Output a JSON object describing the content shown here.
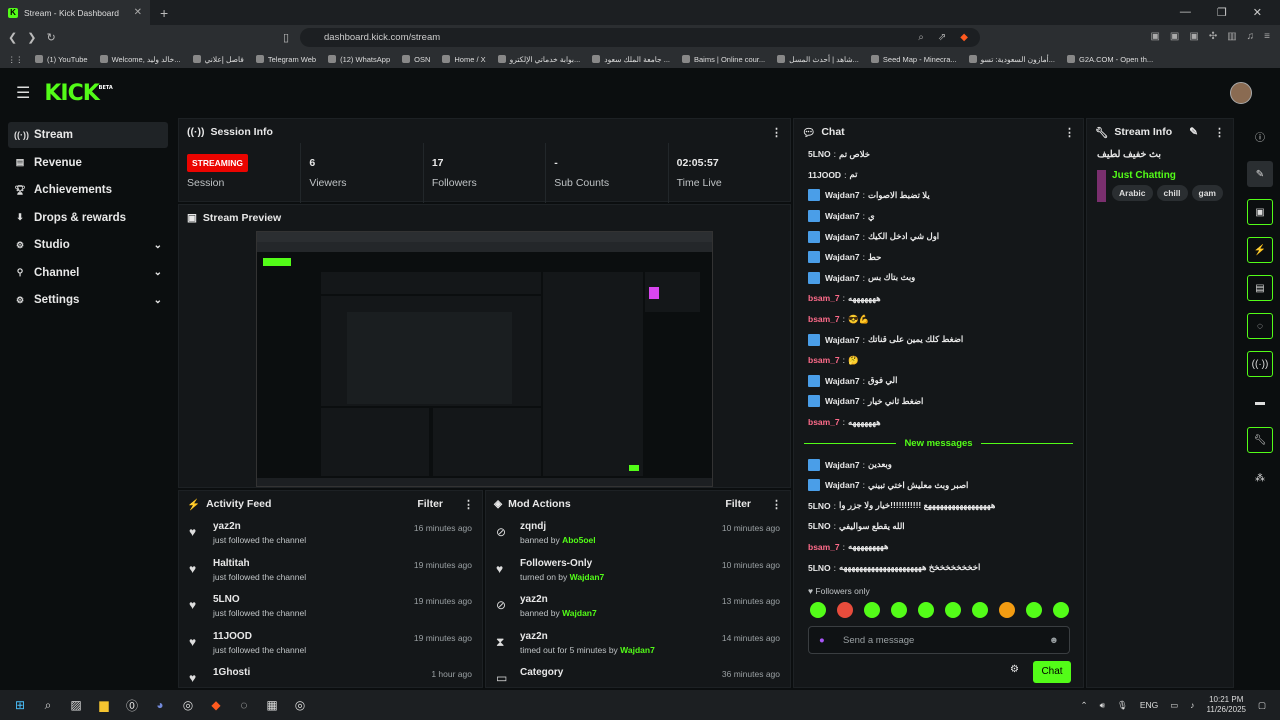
{
  "browser": {
    "tab_title": "Stream - Kick Dashboard",
    "url": "dashboard.kick.com/stream",
    "bookmarks": [
      "(1) YouTube",
      "Welcome, خالد وليد...",
      "فاصل إعلاني",
      "Telegram Web",
      "(12) WhatsApp",
      "OSN",
      "Home / X",
      "بوابة خدماتي الإلكترو...",
      "جامعة الملك سعود ...",
      "Baims | Online cour...",
      "شاهد | أحدث المسل...",
      "Seed Map - Minecra...",
      "أمازون السعودية: تسو...",
      "G2A.COM - Open th..."
    ]
  },
  "brand": {
    "logo": "KICK",
    "beta": "BETA",
    "accent": "#53fc18"
  },
  "sidebar": {
    "items": [
      {
        "label": "Stream"
      },
      {
        "label": "Revenue"
      },
      {
        "label": "Achievements"
      },
      {
        "label": "Drops & rewards"
      },
      {
        "label": "Studio"
      },
      {
        "label": "Channel"
      },
      {
        "label": "Settings"
      }
    ]
  },
  "session": {
    "title": "Session Info",
    "status": "STREAMING",
    "status_label": "Session",
    "viewers": "6",
    "viewers_label": "Viewers",
    "followers": "17",
    "followers_label": "Followers",
    "subs": "-",
    "subs_label": "Sub Counts",
    "time": "02:05:57",
    "time_label": "Time Live"
  },
  "preview": {
    "title": "Stream Preview"
  },
  "activity": {
    "title": "Activity Feed",
    "filter": "Filter",
    "items": [
      {
        "name": "yaz2n",
        "sub": "just followed the channel",
        "time": "16 minutes ago"
      },
      {
        "name": "Haltitah",
        "sub": "just followed the channel",
        "time": "19 minutes ago"
      },
      {
        "name": "5LNO",
        "sub": "just followed the channel",
        "time": "19 minutes ago"
      },
      {
        "name": "11JOOD",
        "sub": "just followed the channel",
        "time": "19 minutes ago"
      },
      {
        "name": "1Ghosti",
        "sub": "",
        "time": "1 hour ago"
      }
    ]
  },
  "mod": {
    "title": "Mod Actions",
    "filter": "Filter",
    "items": [
      {
        "name": "zqndj",
        "pre": "banned by",
        "by": "Abo5oel",
        "time": "10 minutes ago"
      },
      {
        "name": "Followers-Only",
        "pre": "turned on by",
        "by": "Wajdan7",
        "time": "10 minutes ago"
      },
      {
        "name": "yaz2n",
        "pre": "banned by",
        "by": "Wajdan7",
        "time": "13 minutes ago"
      },
      {
        "name": "yaz2n",
        "pre": "timed out for 5 minutes by",
        "by": "Wajdan7",
        "time": "14 minutes ago"
      },
      {
        "name": "Category",
        "pre": "",
        "by": "",
        "time": "36 minutes ago"
      }
    ]
  },
  "chat": {
    "title": "Chat",
    "new_messages": "New messages",
    "followers_only": "Followers only",
    "placeholder": "Send a message",
    "send": "Chat",
    "messages": [
      {
        "user": "5LNO",
        "text": "خلاص تم",
        "mod": false,
        "color": "#e8e8e8"
      },
      {
        "user": "11JOOD",
        "text": "تم",
        "mod": false,
        "color": "#e8e8e8"
      },
      {
        "user": "Wajdan7",
        "text": "يلا تضبط الاصوات",
        "mod": true,
        "color": "#e8e8e8"
      },
      {
        "user": "Wajdan7",
        "text": "ي",
        "mod": true,
        "color": "#e8e8e8"
      },
      {
        "user": "Wajdan7",
        "text": "اول شي ادخل الكيك",
        "mod": true,
        "color": "#e8e8e8"
      },
      {
        "user": "Wajdan7",
        "text": "حط",
        "mod": true,
        "color": "#e8e8e8"
      },
      {
        "user": "Wajdan7",
        "text": "وبث بتاك بس",
        "mod": true,
        "color": "#e8e8e8"
      },
      {
        "user": "bsam_7",
        "text": "هههههههه",
        "mod": false,
        "color": "#ff6b8a"
      },
      {
        "user": "bsam_7",
        "text": "😎💪",
        "mod": false,
        "color": "#ff6b8a"
      },
      {
        "user": "Wajdan7",
        "text": "اضغط كلك يمين على قناتك",
        "mod": true,
        "color": "#e8e8e8"
      },
      {
        "user": "bsam_7",
        "text": "🤔",
        "mod": false,
        "color": "#ff6b8a"
      },
      {
        "user": "Wajdan7",
        "text": "الي فوق",
        "mod": true,
        "color": "#e8e8e8"
      },
      {
        "user": "Wajdan7",
        "text": "اضغط ثاني خيار",
        "mod": true,
        "color": "#e8e8e8"
      },
      {
        "user": "bsam_7",
        "text": "هههههههه",
        "mod": false,
        "color": "#ff6b8a"
      }
    ],
    "new": [
      {
        "user": "Wajdan7",
        "text": "وبعدين",
        "mod": true,
        "color": "#e8e8e8"
      },
      {
        "user": "Wajdan7",
        "text": "اصبر وبث معليش اختي تبيني",
        "mod": true,
        "color": "#e8e8e8"
      },
      {
        "user": "5LNO",
        "text": "هههههههههههههههههع !!!!!!!!!!!خيار ولا جزر وا",
        "mod": false,
        "color": "#e8e8e8"
      },
      {
        "user": "5LNO",
        "text": "الله يقطع سواليفي",
        "mod": false,
        "color": "#e8e8e8"
      },
      {
        "user": "bsam_7",
        "text": "هههههههههه",
        "mod": false,
        "color": "#ff6b8a"
      },
      {
        "user": "5LNO",
        "text": "اخخخخخخخخخ هههههههههههههههههههههه",
        "mod": false,
        "color": "#e8e8e8"
      }
    ]
  },
  "stream_info": {
    "title": "Stream Info",
    "stream_title": "بث خفيف لطيف",
    "category": "Just Chatting",
    "tags": [
      "Arabic",
      "chill",
      "gam"
    ]
  },
  "taskbar": {
    "lang": "ENG",
    "time": "10:21 PM",
    "date": "11/26/2025"
  }
}
